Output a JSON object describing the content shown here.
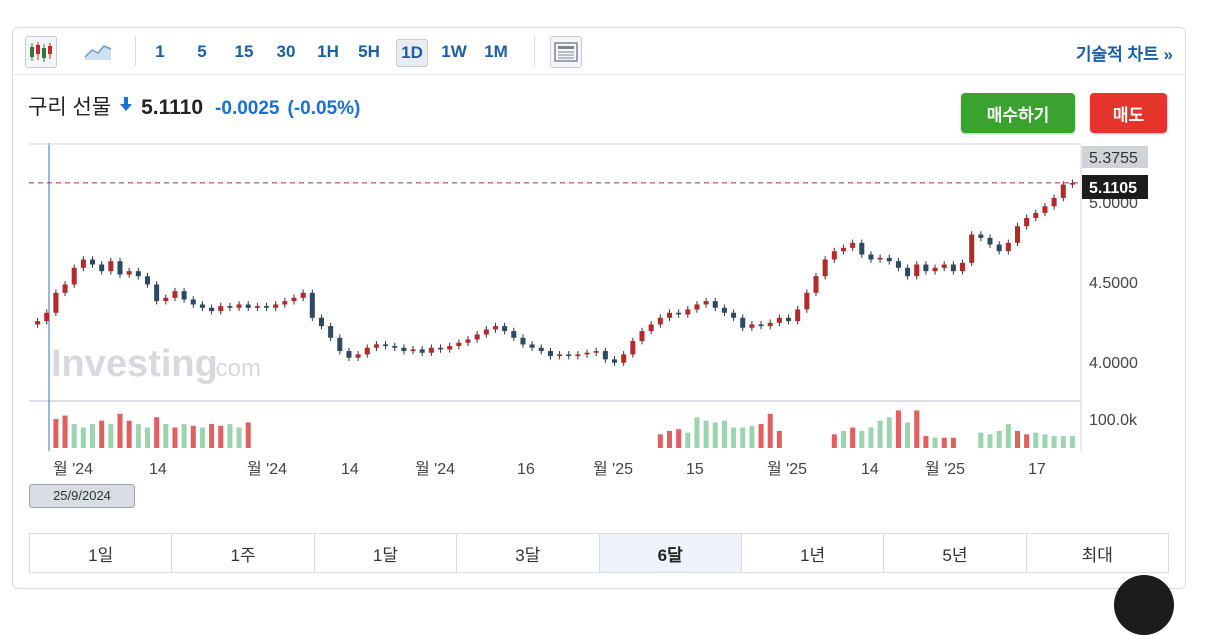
{
  "toolbar": {
    "timeframes": [
      "1",
      "5",
      "15",
      "30",
      "1H",
      "5H",
      "1D",
      "1W",
      "1M"
    ],
    "active_timeframe": "1D",
    "technical_link": "기술적 차트 »"
  },
  "quote": {
    "name": "구리 선물",
    "price": "5.1110",
    "change": "-0.0025",
    "change_pct": "(-0.05%)",
    "direction_icon": "arrow-down-icon"
  },
  "actions": {
    "buy": "매수하기",
    "sell": "매도"
  },
  "chart": {
    "price_labels": [
      "5.3755",
      "5.0000",
      "4.5000",
      "4.0000"
    ],
    "current_price_label": "5.1105",
    "volume_label": "100.0k",
    "x_labels": [
      "월 '24",
      "14",
      "월 '24",
      "14",
      "월 '24",
      "16",
      "월 '25",
      "15",
      "월 '25",
      "14",
      "월 '25",
      "17"
    ],
    "watermark": "Investing",
    "watermark_suffix": ".com",
    "crosshair_date": "25/9/2024"
  },
  "chart_data": {
    "type": "candlestick",
    "ylim": [
      3.8,
      5.35
    ],
    "current_price": 5.1105,
    "colors": {
      "up": "#b22a2a",
      "down": "#2e4a63",
      "vol_up": "#e06060",
      "vol_down": "#9dd4b0",
      "current_line": "#b22a2a"
    },
    "closes": [
      4.28,
      4.33,
      4.45,
      4.5,
      4.6,
      4.65,
      4.62,
      4.58,
      4.64,
      4.56,
      4.58,
      4.55,
      4.5,
      4.4,
      4.42,
      4.46,
      4.41,
      4.38,
      4.36,
      4.34,
      4.37,
      4.36,
      4.38,
      4.36,
      4.37,
      4.36,
      4.38,
      4.4,
      4.42,
      4.45,
      4.3,
      4.25,
      4.18,
      4.1,
      4.06,
      4.08,
      4.12,
      4.14,
      4.13,
      4.12,
      4.1,
      4.11,
      4.09,
      4.12,
      4.11,
      4.13,
      4.15,
      4.17,
      4.2,
      4.23,
      4.25,
      4.22,
      4.18,
      4.14,
      4.12,
      4.1,
      4.07,
      4.08,
      4.07,
      4.08,
      4.09,
      4.1,
      4.05,
      4.03,
      4.08,
      4.16,
      4.22,
      4.26,
      4.3,
      4.33,
      4.32,
      4.35,
      4.38,
      4.4,
      4.36,
      4.33,
      4.3,
      4.24,
      4.26,
      4.25,
      4.27,
      4.3,
      4.28,
      4.35,
      4.45,
      4.55,
      4.65,
      4.7,
      4.72,
      4.75,
      4.68,
      4.65,
      4.66,
      4.64,
      4.6,
      4.55,
      4.62,
      4.58,
      4.6,
      4.62,
      4.58,
      4.63,
      4.8,
      4.78,
      4.74,
      4.7,
      4.75,
      4.85,
      4.9,
      4.93,
      4.97,
      5.02,
      5.1,
      5.11
    ],
    "volume_bars": [
      {
        "i": 2,
        "v": 0.85,
        "up": true
      },
      {
        "i": 3,
        "v": 0.95,
        "up": true
      },
      {
        "i": 4,
        "v": 0.7,
        "up": false
      },
      {
        "i": 5,
        "v": 0.6,
        "up": false
      },
      {
        "i": 6,
        "v": 0.7,
        "up": false
      },
      {
        "i": 7,
        "v": 0.8,
        "up": true
      },
      {
        "i": 8,
        "v": 0.7,
        "up": false
      },
      {
        "i": 9,
        "v": 1.0,
        "up": true
      },
      {
        "i": 10,
        "v": 0.8,
        "up": true
      },
      {
        "i": 11,
        "v": 0.7,
        "up": false
      },
      {
        "i": 12,
        "v": 0.6,
        "up": false
      },
      {
        "i": 13,
        "v": 0.9,
        "up": true
      },
      {
        "i": 14,
        "v": 0.7,
        "up": false
      },
      {
        "i": 15,
        "v": 0.6,
        "up": true
      },
      {
        "i": 16,
        "v": 0.7,
        "up": false
      },
      {
        "i": 17,
        "v": 0.65,
        "up": true
      },
      {
        "i": 18,
        "v": 0.6,
        "up": false
      },
      {
        "i": 19,
        "v": 0.7,
        "up": true
      },
      {
        "i": 20,
        "v": 0.65,
        "up": true
      },
      {
        "i": 21,
        "v": 0.7,
        "up": false
      },
      {
        "i": 22,
        "v": 0.6,
        "up": false
      },
      {
        "i": 23,
        "v": 0.75,
        "up": true
      },
      {
        "i": 68,
        "v": 0.4,
        "up": true
      },
      {
        "i": 69,
        "v": 0.5,
        "up": true
      },
      {
        "i": 70,
        "v": 0.55,
        "up": true
      },
      {
        "i": 71,
        "v": 0.45,
        "up": false
      },
      {
        "i": 72,
        "v": 0.9,
        "up": false
      },
      {
        "i": 73,
        "v": 0.8,
        "up": false
      },
      {
        "i": 74,
        "v": 0.75,
        "up": false
      },
      {
        "i": 75,
        "v": 0.8,
        "up": false
      },
      {
        "i": 76,
        "v": 0.6,
        "up": false
      },
      {
        "i": 77,
        "v": 0.6,
        "up": false
      },
      {
        "i": 78,
        "v": 0.65,
        "up": false
      },
      {
        "i": 79,
        "v": 0.7,
        "up": true
      },
      {
        "i": 80,
        "v": 1.0,
        "up": true
      },
      {
        "i": 81,
        "v": 0.5,
        "up": true
      },
      {
        "i": 87,
        "v": 0.4,
        "up": true
      },
      {
        "i": 88,
        "v": 0.5,
        "up": false
      },
      {
        "i": 89,
        "v": 0.6,
        "up": true
      },
      {
        "i": 90,
        "v": 0.5,
        "up": false
      },
      {
        "i": 91,
        "v": 0.6,
        "up": false
      },
      {
        "i": 92,
        "v": 0.8,
        "up": false
      },
      {
        "i": 93,
        "v": 0.9,
        "up": false
      },
      {
        "i": 94,
        "v": 1.1,
        "up": true
      },
      {
        "i": 95,
        "v": 0.75,
        "up": false
      },
      {
        "i": 96,
        "v": 1.1,
        "up": true
      },
      {
        "i": 97,
        "v": 0.35,
        "up": true
      },
      {
        "i": 98,
        "v": 0.3,
        "up": false
      },
      {
        "i": 99,
        "v": 0.3,
        "up": true
      },
      {
        "i": 100,
        "v": 0.3,
        "up": true
      },
      {
        "i": 103,
        "v": 0.45,
        "up": false
      },
      {
        "i": 104,
        "v": 0.4,
        "up": false
      },
      {
        "i": 105,
        "v": 0.5,
        "up": false
      },
      {
        "i": 106,
        "v": 0.7,
        "up": false
      },
      {
        "i": 107,
        "v": 0.5,
        "up": true
      },
      {
        "i": 108,
        "v": 0.4,
        "up": true
      },
      {
        "i": 109,
        "v": 0.45,
        "up": false
      },
      {
        "i": 110,
        "v": 0.4,
        "up": false
      },
      {
        "i": 111,
        "v": 0.35,
        "up": false
      },
      {
        "i": 112,
        "v": 0.35,
        "up": false
      },
      {
        "i": 113,
        "v": 0.35,
        "up": false
      }
    ]
  },
  "range_tabs": [
    "1일",
    "1주",
    "1달",
    "3달",
    "6달",
    "1년",
    "5년",
    "최대"
  ],
  "active_range": "6달"
}
